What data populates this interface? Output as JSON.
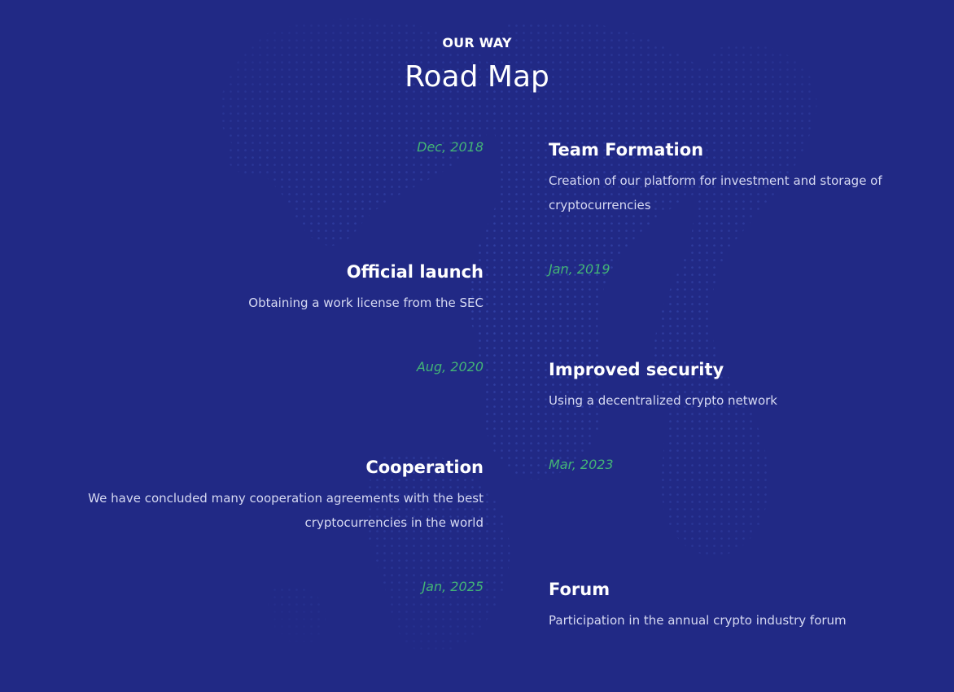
{
  "header": {
    "kicker": "OUR WAY",
    "title": "Road Map"
  },
  "roadmap": [
    {
      "date": "Dec, 2018",
      "title": "Team Formation",
      "description": "Creation of our platform for investment and storage of cryptocurrencies"
    },
    {
      "date": "Jan, 2019",
      "title": "Official launch",
      "description": "Obtaining a work license from the SEC"
    },
    {
      "date": "Aug, 2020",
      "title": "Improved security",
      "description": "Using a decentralized crypto network"
    },
    {
      "date": "Mar, 2023",
      "title": "Cooperation",
      "description": "We have concluded many cooperation agreements with the best cryptocurrencies in the world"
    },
    {
      "date": "Jan, 2025",
      "title": "Forum",
      "description": "Participation in the annual crypto industry forum"
    }
  ],
  "colors": {
    "background": "#212985",
    "date_accent": "#43b476",
    "description_text": "#d6d9f2"
  }
}
